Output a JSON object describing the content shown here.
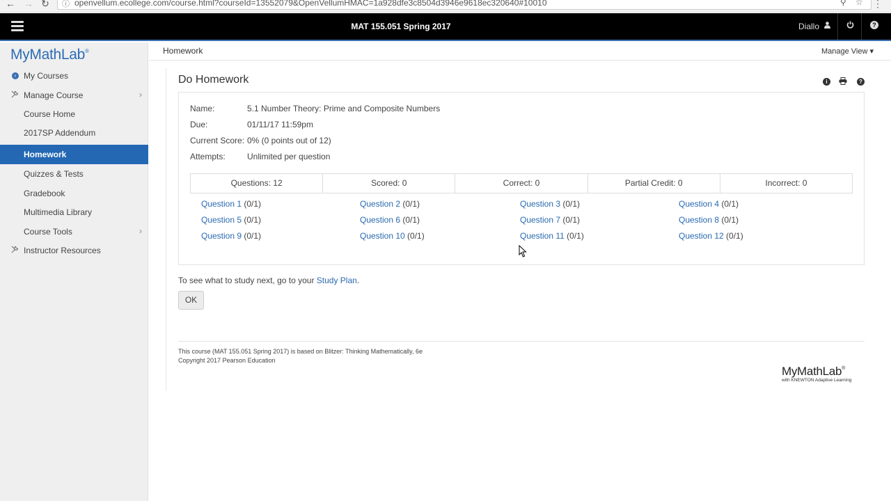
{
  "browser": {
    "url": "openvellum.ecollege.com/course.html?courseId=13552079&OpenVellumHMAC=1a928dfe3c8504d3946e9618ec320640#10010",
    "back_glyph": "←",
    "forward_glyph": "→",
    "reload_glyph": "↻",
    "info_glyph": "ⓘ",
    "zoom_glyph": "⚲",
    "star_glyph": "☆",
    "menu_glyph": "⋮"
  },
  "topbar": {
    "course_title": "MAT 155.051 Spring 2017",
    "user_name": "Diallo",
    "user_glyph": "👤",
    "power_glyph": "⏻",
    "help_glyph": "?"
  },
  "sidebar": {
    "logo": "MyMathLab",
    "logo_mark": "®",
    "items": [
      {
        "label": "My Courses",
        "icon": "back-arrow-icon"
      },
      {
        "label": "Manage Course",
        "icon": "tools-icon",
        "chevron": "›"
      },
      {
        "label": "Course Home"
      },
      {
        "label": "2017SP Addendum"
      },
      {
        "label": "Homework",
        "active": true
      },
      {
        "label": "Quizzes & Tests"
      },
      {
        "label": "Gradebook"
      },
      {
        "label": "Multimedia Library"
      },
      {
        "label": "Course Tools",
        "chevron": "›"
      },
      {
        "label": "Instructor Resources",
        "icon": "tools-icon"
      }
    ],
    "active_color": "#2468b4"
  },
  "header": {
    "breadcrumb": "Homework",
    "manage_view": "Manage View ▾"
  },
  "homework": {
    "title": "Do Homework",
    "info_glyph": "i",
    "print_glyph": "⎙",
    "help_glyph": "?",
    "fields": {
      "name_label": "Name:",
      "name_value": "5.1 Number Theory: Prime and Composite Numbers",
      "due_label": "Due:",
      "due_value": "01/11/17 11:59pm",
      "score_label": "Current Score:",
      "score_value": "0% (0 points out of 12)",
      "attempts_label": "Attempts:",
      "attempts_value": "Unlimited per question"
    },
    "stats": [
      "Questions: 12",
      "Scored: 0",
      "Correct: 0",
      "Partial Credit: 0",
      "Incorrect: 0"
    ],
    "questions": [
      {
        "name": "Question 1",
        "score": " (0/1)"
      },
      {
        "name": "Question 2",
        "score": " (0/1)"
      },
      {
        "name": "Question 3",
        "score": " (0/1)"
      },
      {
        "name": "Question 4",
        "score": " (0/1)"
      },
      {
        "name": "Question 5",
        "score": " (0/1)"
      },
      {
        "name": "Question 6",
        "score": " (0/1)"
      },
      {
        "name": "Question 7",
        "score": " (0/1)"
      },
      {
        "name": "Question 8",
        "score": " (0/1)"
      },
      {
        "name": "Question 9",
        "score": " (0/1)"
      },
      {
        "name": "Question 10",
        "score": " (0/1)"
      },
      {
        "name": "Question 11",
        "score": " (0/1)"
      },
      {
        "name": "Question 12",
        "score": " (0/1)"
      }
    ],
    "study_prefix": "To see what to study next, go to your ",
    "study_link": "Study Plan",
    "study_suffix": ".",
    "ok_label": "OK",
    "link_color": "#2a6ab0"
  },
  "footer": {
    "line1": "This course (MAT 155.051 Spring 2017) is based on Blitzer: Thinking Mathematically, 6e",
    "line2": "Copyright 2017 Pearson Education",
    "brand_main": "MyMathLab",
    "brand_mark": "®",
    "brand_sub": "with KNEWTON Adaptive Learning"
  }
}
